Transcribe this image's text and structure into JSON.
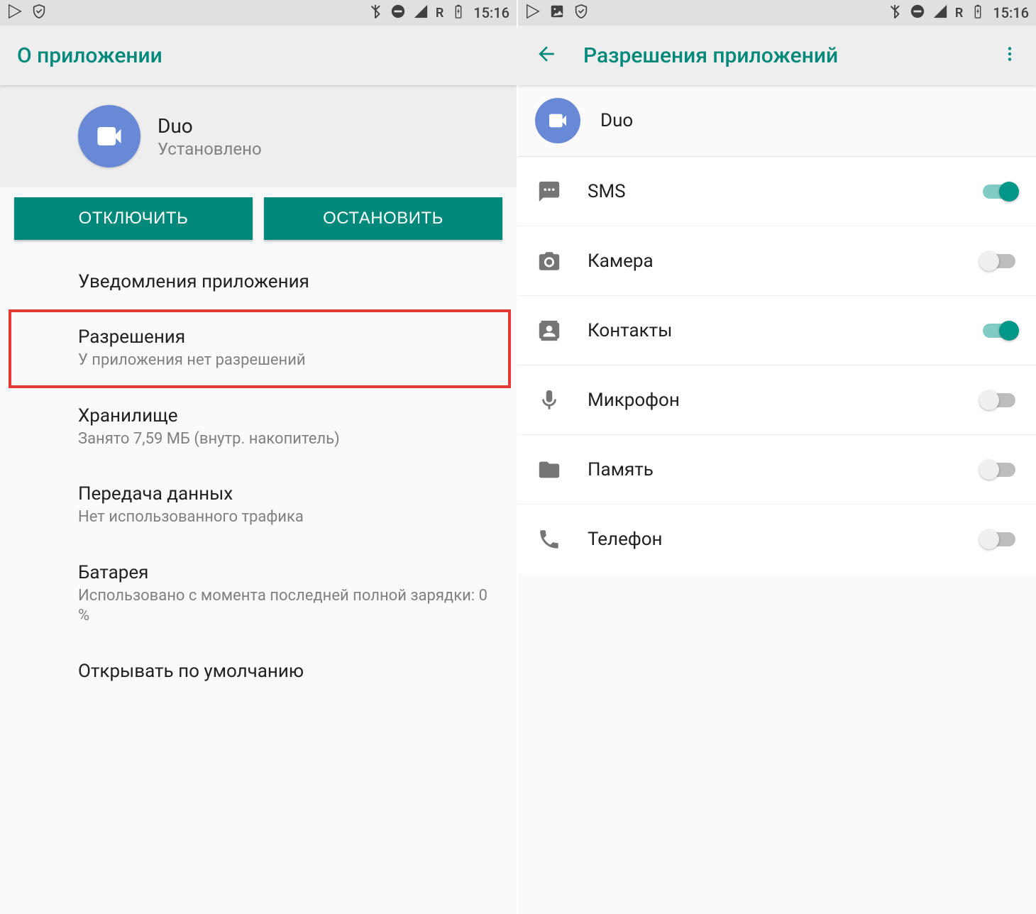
{
  "status": {
    "time": "15:16",
    "r_label": "R"
  },
  "left": {
    "appbar_title": "О приложении",
    "app_name": "Duo",
    "app_status": "Установлено",
    "btn_disable": "ОТКЛЮЧИТЬ",
    "btn_stop": "ОСТАНОВИТЬ",
    "rows": {
      "notifications_title": "Уведомления приложения",
      "permissions_title": "Разрешения",
      "permissions_sub": "У приложения нет разрешений",
      "storage_title": "Хранилище",
      "storage_sub": "Занято 7,59 МБ (внутр. накопитель)",
      "data_title": "Передача данных",
      "data_sub": "Нет использованного трафика",
      "battery_title": "Батарея",
      "battery_sub": "Использовано с момента последней полной зарядки: 0 %",
      "open_default_title": "Открывать по умолчанию"
    }
  },
  "right": {
    "appbar_title": "Разрешения приложений",
    "app_name": "Duo",
    "perms": [
      {
        "label": "SMS",
        "icon": "sms",
        "on": true
      },
      {
        "label": "Камера",
        "icon": "camera",
        "on": false
      },
      {
        "label": "Контакты",
        "icon": "contacts",
        "on": true
      },
      {
        "label": "Микрофон",
        "icon": "mic",
        "on": false
      },
      {
        "label": "Память",
        "icon": "folder",
        "on": false
      },
      {
        "label": "Телефон",
        "icon": "phone",
        "on": false
      }
    ]
  }
}
